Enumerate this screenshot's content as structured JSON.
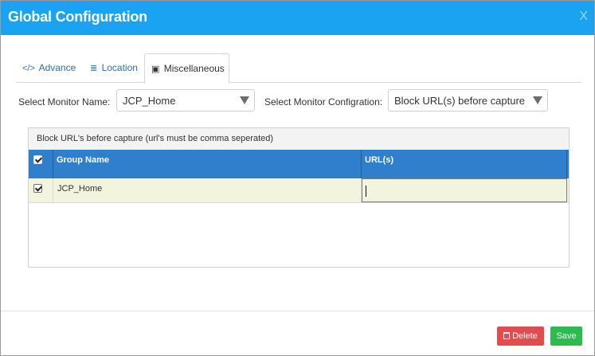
{
  "dialog": {
    "title": "Global Configuration",
    "close_label": "X"
  },
  "tabs": [
    {
      "icon": "</>",
      "label": "Advance",
      "icon_name": "code-icon"
    },
    {
      "icon": "≣",
      "label": "Location",
      "icon_name": "sliders-icon"
    },
    {
      "icon": "▣",
      "label": "Miscellaneous",
      "icon_name": "book-icon",
      "active": true
    }
  ],
  "form": {
    "monitor_label": "Select Monitor Name:",
    "monitor_value": "JCP_Home",
    "config_label": "Select Monitor Configration:",
    "config_value": "Block URL(s) before capture"
  },
  "panel": {
    "heading": "Block URL's before capture (url's must be comma seperated)",
    "columns": [
      "Group Name",
      "URL(s)"
    ],
    "rows": [
      {
        "checked": true,
        "group_name": "JCP_Home",
        "urls": ""
      }
    ]
  },
  "footer": {
    "delete_label": "Delete",
    "save_label": "Save"
  },
  "colors": {
    "titlebar": "#1aa3f0",
    "grid_header": "#2f7fcc",
    "row_bg": "#f2f4dd",
    "delete": "#e24c4c",
    "save": "#2dbb4e"
  }
}
